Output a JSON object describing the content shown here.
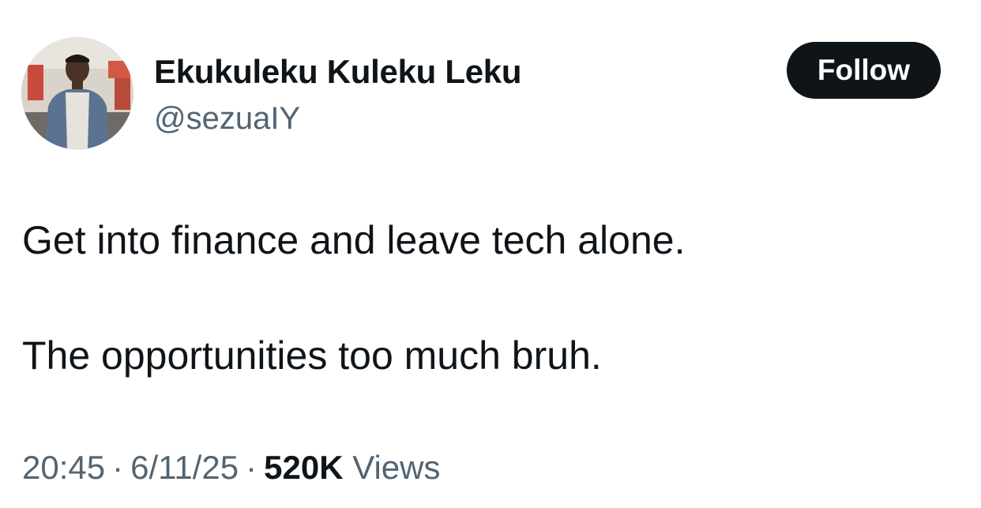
{
  "author": {
    "display_name": "Ekukuleku Kuleku Leku",
    "handle": "@sezuaIY",
    "avatar_icon": "profile-photo"
  },
  "follow_button": {
    "label": "Follow"
  },
  "tweet": {
    "lines": [
      "Get into finance and leave tech alone.",
      "The opportunities too much bruh."
    ]
  },
  "meta": {
    "time": "20:45",
    "date": "6/11/25",
    "separator": "·",
    "views_count": "520K",
    "views_label": "Views"
  },
  "colors": {
    "text_primary": "#0f1419",
    "text_secondary": "#536471",
    "button_bg": "#0f1419",
    "button_text": "#ffffff"
  }
}
